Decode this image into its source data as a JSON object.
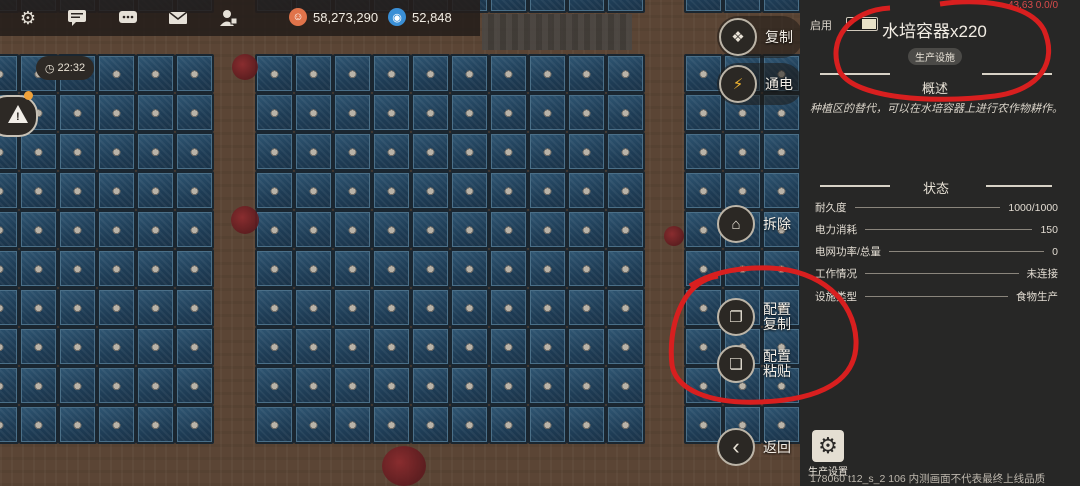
{
  "topbar": {
    "icons": [
      "gear-icon",
      "chat-icon",
      "message-icon",
      "mail-icon",
      "player-icon"
    ],
    "resource1": {
      "icon": "population-icon",
      "value": "58,273,290",
      "color": "#e0734a"
    },
    "resource2": {
      "icon": "tech-icon",
      "value": "52,848",
      "color": "#3a8fd6"
    }
  },
  "clock": {
    "time": "22:32"
  },
  "actions": {
    "copy": "复制",
    "power": "通电",
    "dismantle": "拆除",
    "config_copy_1": "配置",
    "config_copy_2": "复制",
    "config_paste_1": "配置",
    "config_paste_2": "粘贴",
    "back": "返回"
  },
  "panel": {
    "fps_overlay": "43.63 0.0/0",
    "enable_label": "启用",
    "title": "水培容器x220",
    "tag": "生产设施",
    "overview_header": "概述",
    "description": "种植区的替代，可以在水培容器上进行农作物耕作。",
    "status_header": "状态",
    "stats": [
      {
        "label": "耐久度",
        "value": "1000/1000"
      },
      {
        "label": "电力消耗",
        "value": "150"
      },
      {
        "label": "电网功率/总量",
        "value": "0"
      },
      {
        "label": "工作情况",
        "value": "未连接"
      },
      {
        "label": "设施类型",
        "value": "食物生产"
      }
    ],
    "settings_button": "生产设置",
    "footer": "178060 t12_s_2 106 内测画面不代表最终上线品质"
  },
  "colors": {
    "annotation": "#d81f1f",
    "panel_bg": "#272726",
    "tile": "#24445e"
  }
}
